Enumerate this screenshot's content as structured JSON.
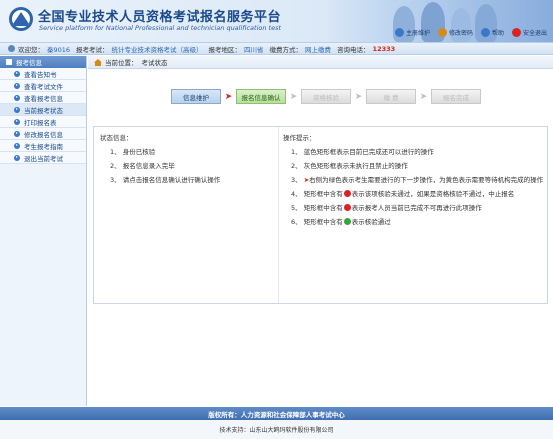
{
  "header": {
    "title_cn": "全国专业技术人员资格考试报名服务平台",
    "title_en": "Service platform for National Professional and technician qualification test",
    "links": [
      {
        "label": "主册维护",
        "icon": "user-edit-icon",
        "color": "#3a78c9"
      },
      {
        "label": "修改密码",
        "icon": "key-icon",
        "color": "#d68a1a"
      },
      {
        "label": "帮助",
        "icon": "help-icon",
        "color": "#3a78c9"
      },
      {
        "label": "安全退出",
        "icon": "exit-icon",
        "color": "#d22"
      }
    ]
  },
  "infobar": {
    "welcome_label": "欢迎您：",
    "user_name": "秦9016",
    "exam_label": "报考考试：",
    "exam_value": "统计专业技术资格考试（高级）",
    "region_label": "报考地区：",
    "region_value": "四川省",
    "pay_label": "缴费方式：",
    "pay_value": "网上缴费",
    "phone_label": "咨询电话：",
    "phone_value": "12333"
  },
  "sidebar": {
    "title": "报考信息",
    "items": [
      {
        "label": "查看告知书"
      },
      {
        "label": "查看考试文件"
      },
      {
        "label": "查看报考信息"
      },
      {
        "label": "当前报考状态"
      },
      {
        "label": "打印报名表"
      },
      {
        "label": "修改报名信息"
      },
      {
        "label": "考生报考指南"
      },
      {
        "label": "退出当前考试"
      }
    ]
  },
  "crumb": {
    "label": "当前位置：",
    "value": "考试状态"
  },
  "steps": [
    {
      "label": "信息维护",
      "state": "blue"
    },
    {
      "label": "报名信息确认",
      "state": "green"
    },
    {
      "label": "资格核验",
      "state": "gray"
    },
    {
      "label": "缴 费",
      "state": "gray"
    },
    {
      "label": "报名完成",
      "state": "gray"
    }
  ],
  "status": {
    "title": "状态信息：",
    "items": [
      "1、 身份已核验",
      "2、 报名信息录入完毕",
      "3、 请点击报名信息确认进行确认操作"
    ]
  },
  "tips": {
    "title": "操作提示：",
    "items": [
      {
        "pre": "1、 蓝色矩形框表示目前已完成还可以进行的操作",
        "badge": "",
        "post": ""
      },
      {
        "pre": "2、 灰色矩形框表示未执行且禁止的操作",
        "badge": "",
        "post": ""
      },
      {
        "pre": "3、 ",
        "badge": "arrow",
        "post": "右侧为绿色表示考生需要进行的下一步操作，为黄色表示需要等待机构完成的操作"
      },
      {
        "pre": "4、 矩形框中含有",
        "badge": "red",
        "post": "表示该项核验未通过，如果是资格核验不通过，中止报名"
      },
      {
        "pre": "5、 矩形框中含有",
        "badge": "red",
        "post": "表示报考人员当前已完成不可再进行此项操作"
      },
      {
        "pre": "6、 矩形框中含有",
        "badge": "green",
        "post": "表示核验通过"
      }
    ],
    "arrow_glyph": "➤"
  },
  "footer": {
    "copyright": "版权所有：人力资源和社会保障部人事考试中心",
    "support": "技术支持：山东山大鸥玛软件股份有限公司"
  },
  "colors": {
    "accent": "#3a78c9",
    "danger": "#d22",
    "success": "#3aa53a"
  }
}
